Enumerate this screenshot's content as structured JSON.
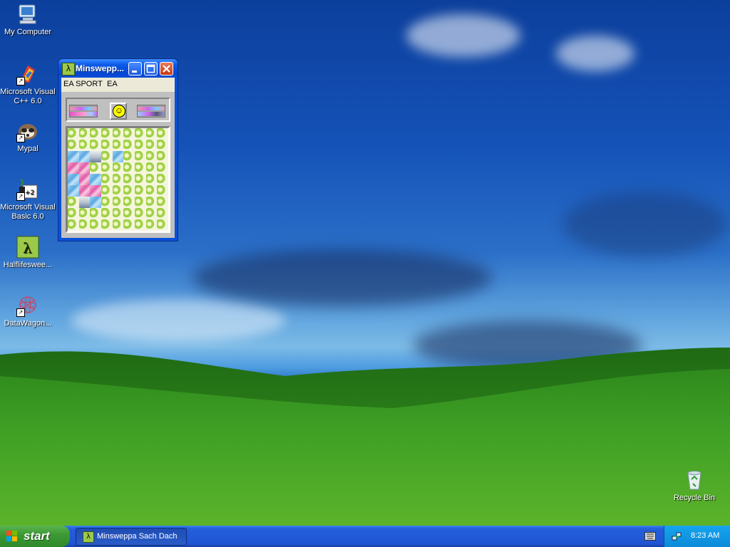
{
  "desktop": {
    "icons": [
      {
        "label": "My Computer",
        "icon": "my-computer-icon"
      },
      {
        "label": "Microsoft Visual C++ 6.0",
        "icon": "visual-cpp-icon"
      },
      {
        "label": "Mypal",
        "icon": "mypal-icon"
      },
      {
        "label": "Microsoft Visual Basic 6.0",
        "icon": "visual-basic-icon"
      },
      {
        "label": "Halflifeswee...",
        "icon": "lambda-icon"
      },
      {
        "label": "DataWagon...",
        "icon": "datawagon-icon"
      },
      {
        "label": "Recycle Bin",
        "icon": "recycle-bin-icon"
      }
    ]
  },
  "window": {
    "title": "Minswepp...",
    "menu": [
      "EA SPORT",
      "EA"
    ],
    "face": "☺",
    "grid": [
      "ggggggggg",
      "ggggggggg",
      "bbogbgggg",
      "ppggggggg",
      "bpbgggggg",
      "bppgggggg",
      "gobgggggg",
      "ggggggggg",
      "ggggggggg"
    ]
  },
  "taskbar": {
    "start_label": "start",
    "task_label": "Minsweppa Sach Dach",
    "clock": "8:23 AM"
  },
  "colors": {
    "title_active": "#0a50d8",
    "start_green": "#3c9a34",
    "taskbar_blue": "#245edb",
    "tray_blue": "#0d8ad8"
  }
}
